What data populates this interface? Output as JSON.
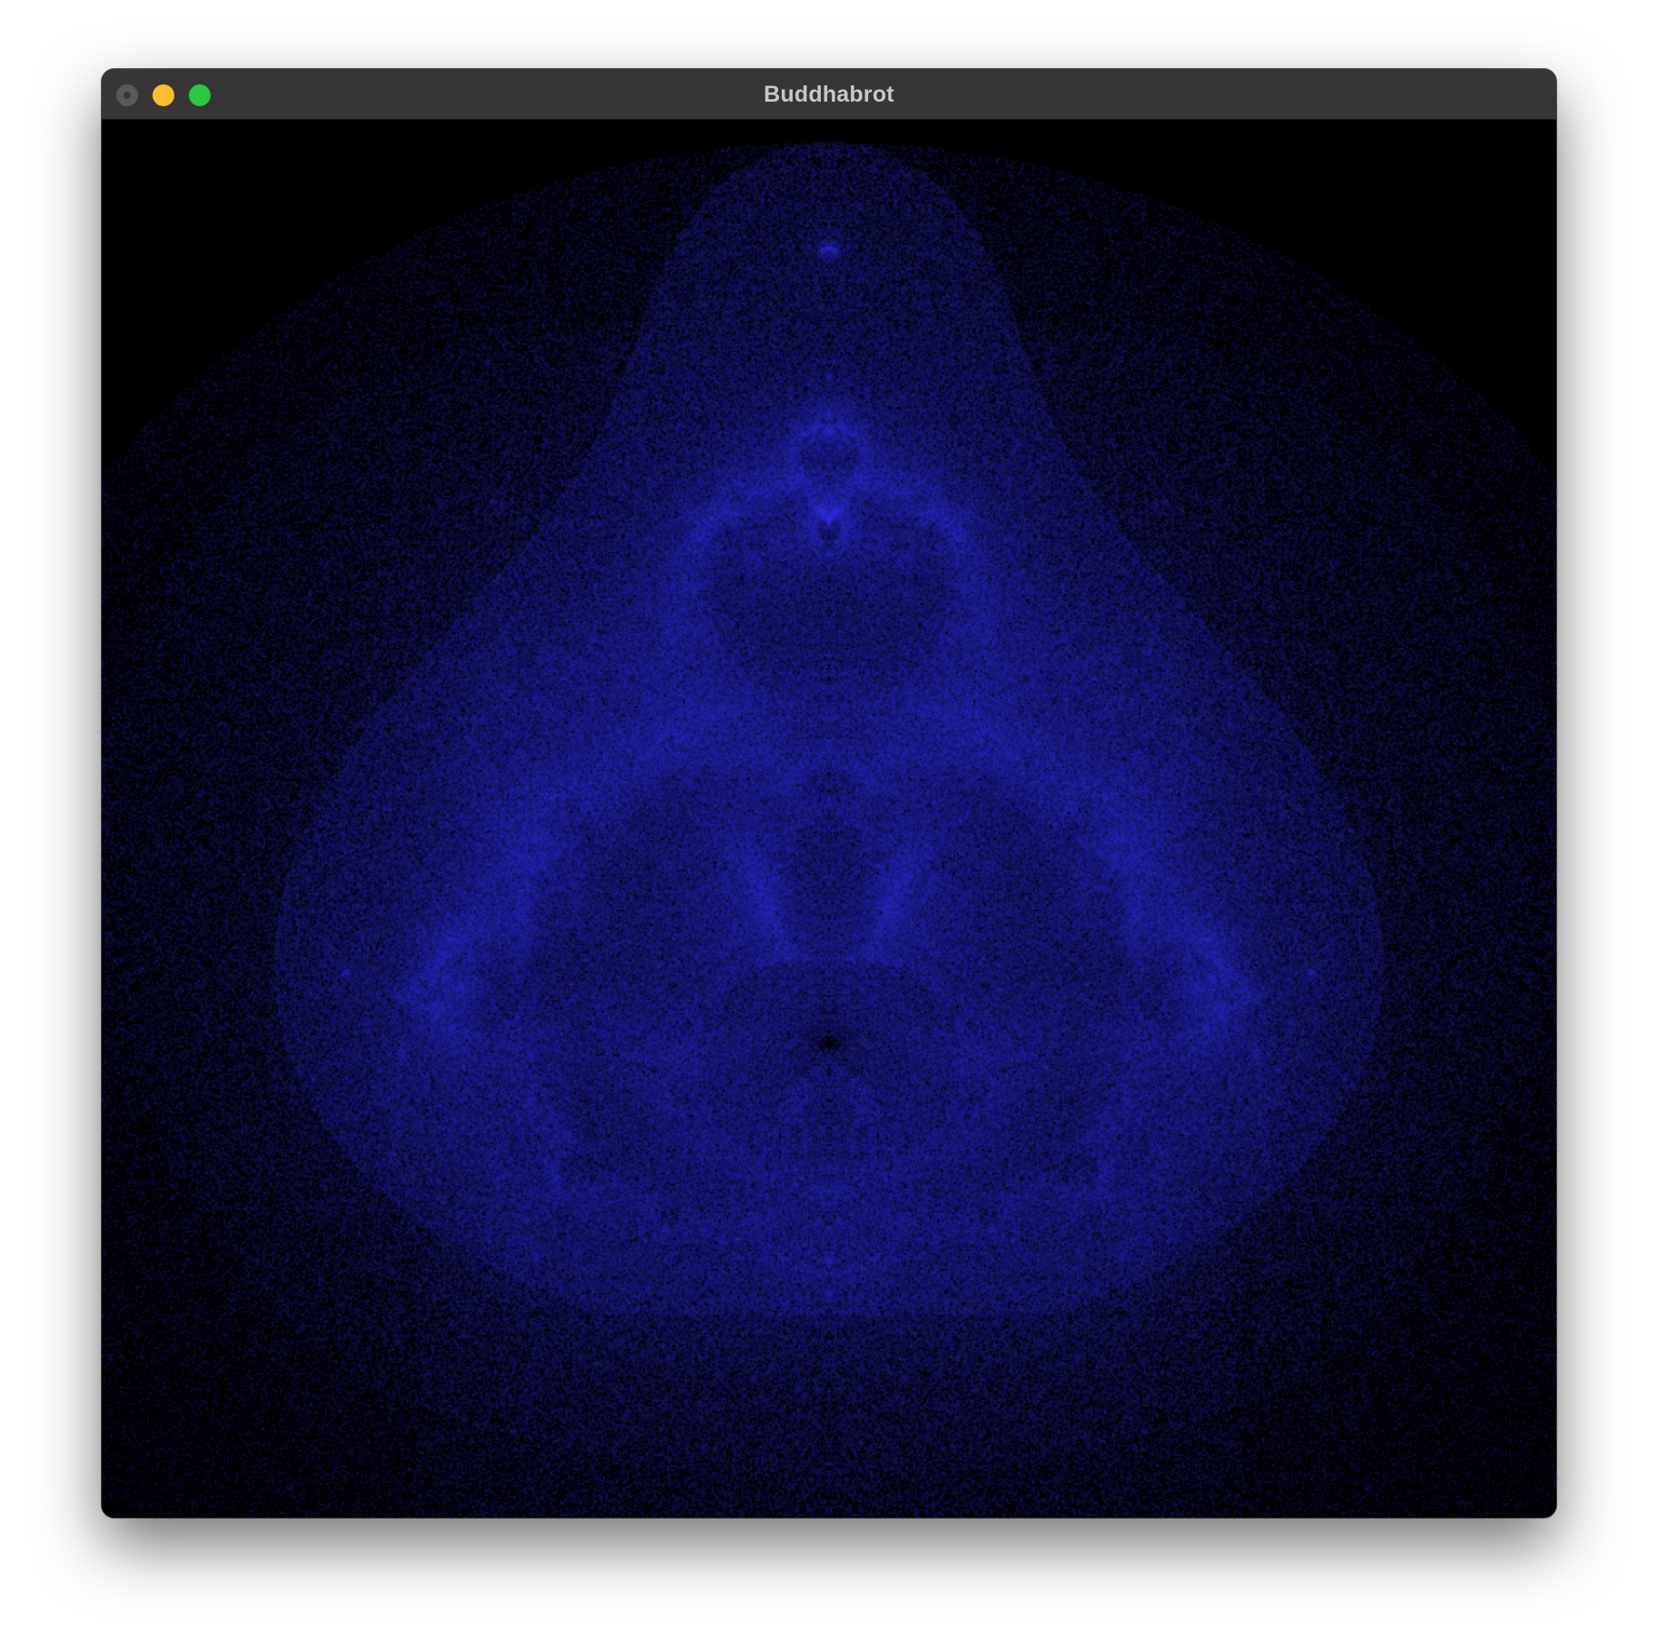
{
  "window": {
    "title": "Buddhabrot",
    "controls": {
      "close_color": "#5a585a",
      "minimize_color": "#febc2e",
      "zoom_color": "#28c840"
    }
  },
  "render": {
    "background_color": "#000000",
    "glow_color": "#2626d6",
    "description_icon": "buddhabrot-fractal"
  }
}
